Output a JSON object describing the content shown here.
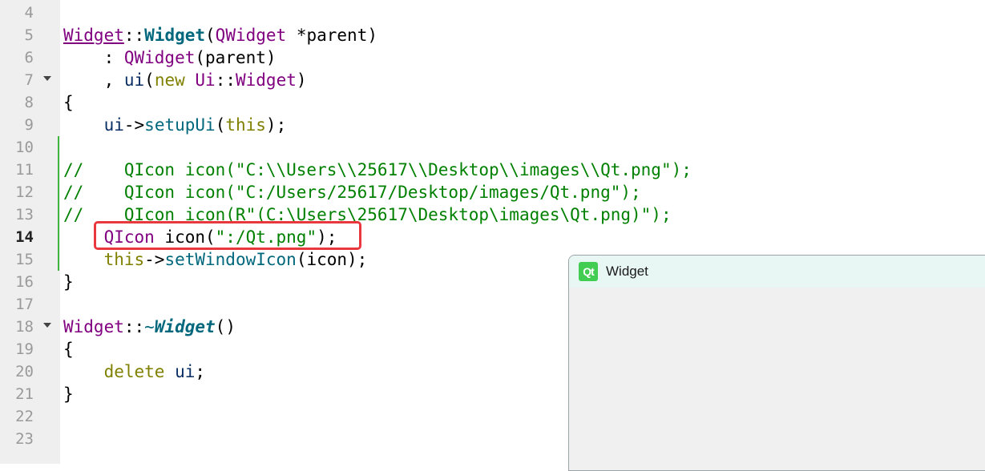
{
  "editor": {
    "line_numbers": [
      "4",
      "5",
      "6",
      "7",
      "8",
      "9",
      "10",
      "11",
      "12",
      "13",
      "14",
      "15",
      "16",
      "17",
      "18",
      "19",
      "20",
      "21",
      "22",
      "23"
    ],
    "current_line": "14",
    "lines": {
      "l5": [
        "Widget",
        "::",
        "Widget",
        "(",
        "QWidget",
        " *parent)"
      ],
      "l6": [
        "    : ",
        "QWidget",
        "(parent)"
      ],
      "l7": [
        "    , ",
        "ui",
        "(",
        "new",
        " ",
        "Ui",
        "::",
        "Widget",
        ")"
      ],
      "l8": [
        "{"
      ],
      "l9": [
        "    ",
        "ui",
        "->",
        "setupUi",
        "(",
        "this",
        ");"
      ],
      "l11": [
        "//    QIcon icon(\"C:\\\\Users\\\\25617\\\\Desktop\\\\images\\\\Qt.png\");"
      ],
      "l12": [
        "//    QIcon icon(\"C:/Users/25617/Desktop/images/Qt.png\");"
      ],
      "l13": [
        "//    QIcon icon(R\"(C:\\Users\\25617\\Desktop\\images\\Qt.png)\");"
      ],
      "l14": [
        "    ",
        "QIcon",
        " icon(",
        "\":/Qt.png\"",
        ");"
      ],
      "l15": [
        "    ",
        "this",
        "->",
        "setWindowIcon",
        "(icon);"
      ],
      "l16": [
        "}"
      ],
      "l18": [
        "Widget",
        "::",
        "~",
        "Widget",
        "()"
      ],
      "l19": [
        "{"
      ],
      "l20": [
        "    ",
        "delete",
        " ",
        "ui",
        ";"
      ],
      "l21": [
        "}"
      ]
    }
  },
  "qt_window": {
    "logo_text": "Qt",
    "title": "Widget"
  },
  "colors": {
    "class": "#800080",
    "keyword": "#808000",
    "function": "#00677c",
    "string": "#008000",
    "comment": "#008000",
    "highlight_box": "#e8383d",
    "qt_green": "#41cd52"
  }
}
